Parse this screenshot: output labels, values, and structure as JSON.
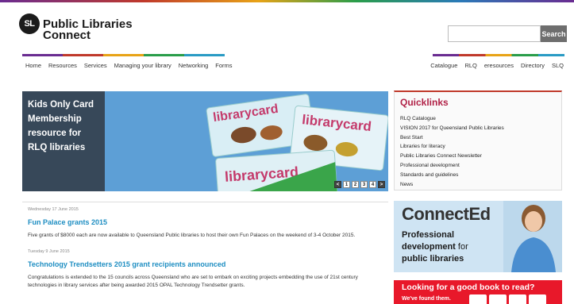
{
  "header": {
    "logo_mark": "SL",
    "logo_line1": "Public Libraries",
    "logo_line2": "Connect",
    "search_placeholder": "",
    "search_label": "Search"
  },
  "nav_left": [
    "Home",
    "Resources",
    "Services",
    "Managing your library",
    "Networking",
    "Forms"
  ],
  "nav_right": [
    "Catalogue",
    "RLQ",
    "eresources",
    "Directory",
    "SLQ"
  ],
  "slider": {
    "caption": "Kids Only Card Membership resource for RLQ libraries",
    "card_text": "librarycard",
    "pages": [
      "1",
      "2",
      "3",
      "4"
    ],
    "prev": "<",
    "next": ">"
  },
  "news": [
    {
      "date": "Wednesday 17 June 2015",
      "title": "Fun Palace grants 2015",
      "body": "Five grants of $8000 each are now available to Queensland Public libraries to host their own Fun Palaces on the weekend of 3-4 October 2015."
    },
    {
      "date": "Tuesday 9 June 2015",
      "title": "Technology Trendsetters 2015 grant recipients announced",
      "body": "Congratulations is extended to the 15 councils across Queensland who are set to embark on exciting projects embedding the use of 21st century technologies in library services after being awarded 2015 OPAL Technology Trendsetter grants."
    }
  ],
  "quicklinks": {
    "title": "Quicklinks",
    "items": [
      "RLQ Catalogue",
      "VISION 2017 for Queensland Public Libraries",
      "Best Start",
      "Libraries for literacy",
      "Public Libraries Connect Newsletter",
      "Professional development",
      "Standards and guidelines",
      "News"
    ]
  },
  "promo": {
    "title": "ConnectEd",
    "line1": "Professional",
    "line2a": "development",
    "line2b": " for",
    "line3": "public libraries"
  },
  "book": {
    "title": "Looking for a good book to read?",
    "subtitle": "We've found them."
  },
  "colors": {
    "accent_blue": "#1e8ec2",
    "quicklinks_red": "#b12247",
    "book_red": "#e8182a"
  }
}
